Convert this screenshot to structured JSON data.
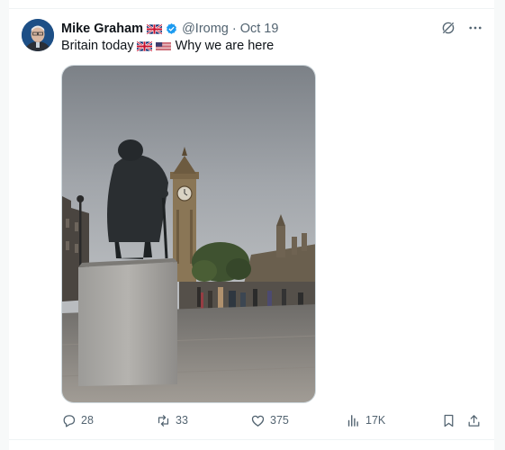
{
  "tweet": {
    "author_name": "Mike Graham",
    "handle": "@Iromg",
    "separator": "·",
    "date": "Oct 19",
    "text_part1": "Britain today",
    "text_part2": "Why we are here",
    "media_icon_names": [
      "uk-flag-icon",
      "us-flag-icon"
    ]
  },
  "actions": {
    "replies": "28",
    "reposts": "33",
    "likes": "375",
    "views": "17K"
  },
  "colors": {
    "text": "#0f1419",
    "secondary": "#536471",
    "verified": "#1d9bf0",
    "border": "#cfd9de"
  }
}
